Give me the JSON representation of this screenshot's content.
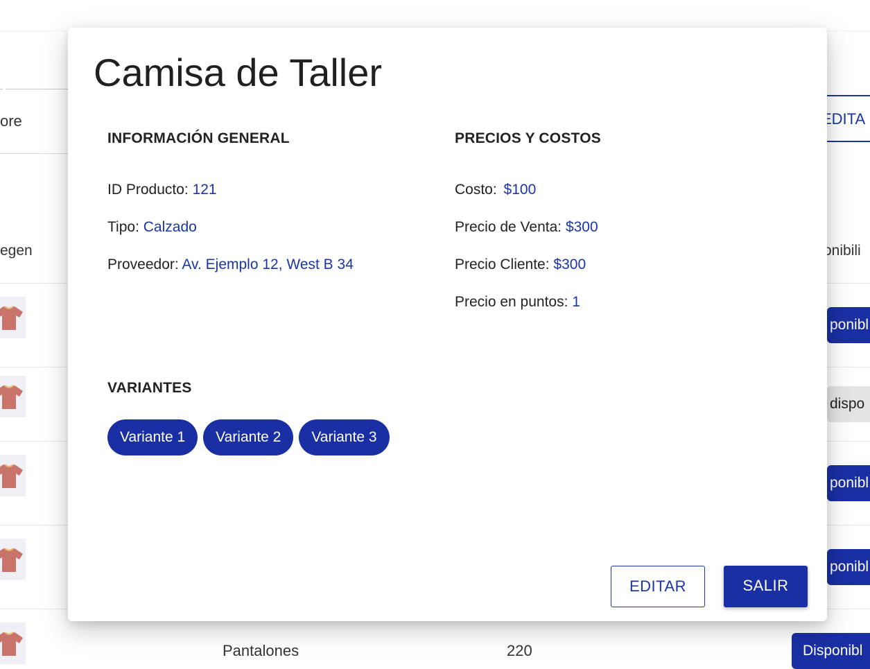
{
  "background": {
    "search_text": "ore",
    "edit_label": "EDITA",
    "col_image_partial": "egen",
    "col_availability_partial": "onibili",
    "rows": [
      {
        "status": "ponibl",
        "state": "on"
      },
      {
        "status": "dispo",
        "state": "off"
      },
      {
        "status": "ponibl",
        "state": "on"
      },
      {
        "status": "ponibl",
        "state": "on"
      }
    ],
    "last_row": {
      "category": "Pantalones",
      "quantity": "220",
      "status": "Disponibl"
    }
  },
  "modal": {
    "title": "Camisa de Taller",
    "general": {
      "heading": "INFORMACIÓN GENERAL",
      "id_label": "ID Producto:",
      "id_value": "121",
      "type_label": "Tipo:",
      "type_value": "Calzado",
      "supplier_label": "Proveedor:",
      "supplier_value": "Av. Ejemplo 12, West B 34"
    },
    "prices": {
      "heading": "PRECIOS Y COSTOS",
      "cost_label": "Costo:",
      "cost_value": "$100",
      "sale_label": "Precio de Venta:",
      "sale_value": "$300",
      "client_label": "Precio Cliente:",
      "client_value": "$300",
      "points_label": "Precio en puntos:",
      "points_value": "1"
    },
    "variants": {
      "heading": "VARIANTES",
      "items": [
        "Variante 1",
        "Variante 2",
        "Variante 3"
      ]
    },
    "actions": {
      "edit_label": "EDITAR",
      "exit_label": "SALIR"
    }
  },
  "colors": {
    "accent": "#1a2fa3",
    "link_value": "#1a36a6",
    "shirt": "#c9746b"
  },
  "icons": {
    "product_thumbnail": "tshirt-icon"
  }
}
